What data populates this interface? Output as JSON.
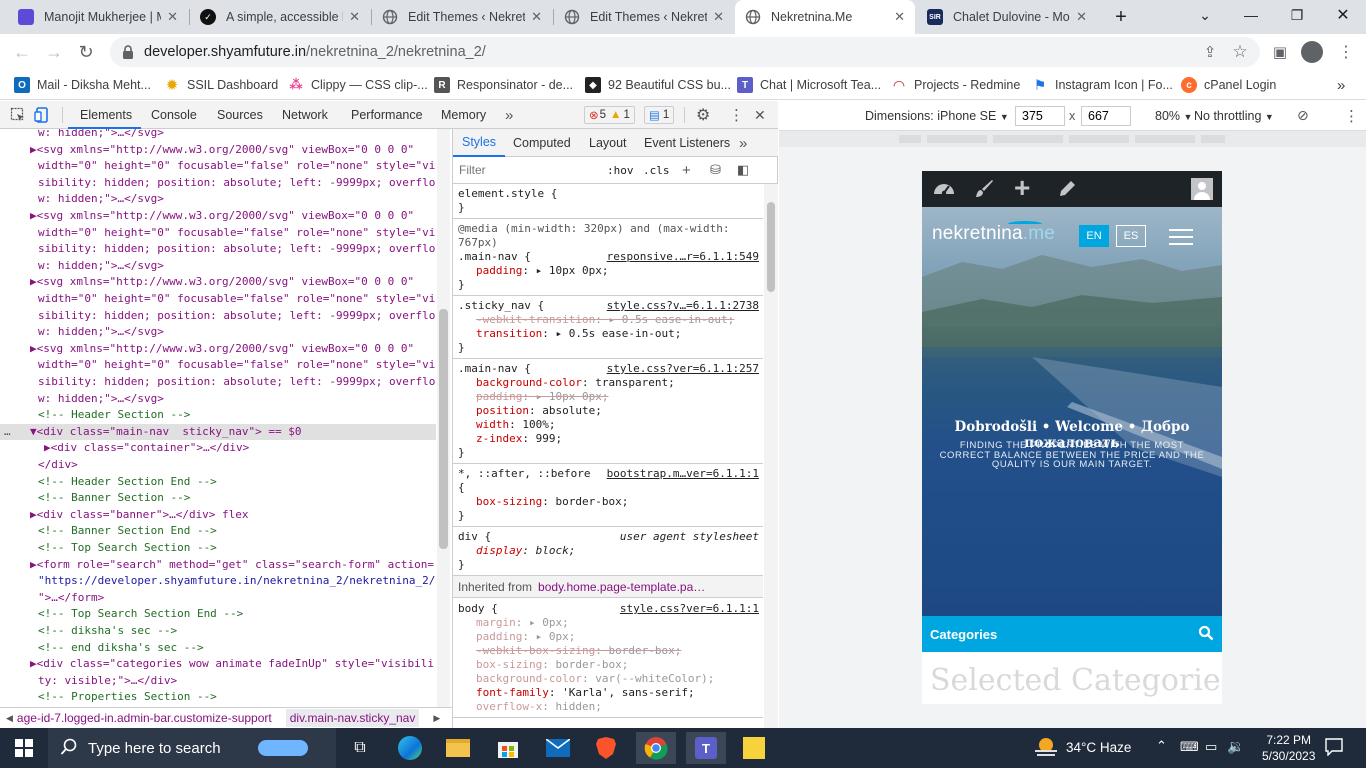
{
  "browser": {
    "tabs": [
      {
        "title": "Manojit Mukherjee | M",
        "favicon_color": "#5b4bd6",
        "favicon_text": "",
        "active": false
      },
      {
        "title": "A simple, accessible la",
        "favicon_color": "#111111",
        "favicon_text": "✓",
        "active": false
      },
      {
        "title": "Edit Themes ‹ Nekretn",
        "favicon_color": "#5f6368",
        "favicon_text": "",
        "active": false
      },
      {
        "title": "Edit Themes ‹ Nekretn",
        "favicon_color": "#5f6368",
        "favicon_text": "",
        "active": false
      },
      {
        "title": "Nekretnina.Me",
        "favicon_color": "#5f6368",
        "favicon_text": "",
        "active": true
      },
      {
        "title": "Chalet Dulovine - Mon",
        "favicon_color": "#1b2a5c",
        "favicon_text": "SIR",
        "active": false
      }
    ],
    "new_tab_label": "+",
    "url_domain": "developer.shyamfuture.in",
    "url_path": "/nekretnina_2/nekretnina_2/",
    "bookmarks": [
      {
        "label": "Mail - Diksha Meht...",
        "color": "#0f6cbd",
        "glyph": "O"
      },
      {
        "label": "SSIL Dashboard",
        "color": "#e8a800",
        "glyph": "✹"
      },
      {
        "label": "Clippy — CSS clip-...",
        "color": "#e84393",
        "glyph": "⁂"
      },
      {
        "label": "Responsinator - de...",
        "color": "#555555",
        "glyph": "R"
      },
      {
        "label": "92 Beautiful CSS bu...",
        "color": "#222222",
        "glyph": "◆"
      },
      {
        "label": "Chat | Microsoft Tea...",
        "color": "#5b5fc7",
        "glyph": "T"
      },
      {
        "label": "Projects - Redmine",
        "color": "#b32024",
        "glyph": "◠"
      },
      {
        "label": "Instagram Icon | Fo...",
        "color": "#1a73e8",
        "glyph": "⚑"
      },
      {
        "label": "cPanel Login",
        "color": "#ff6c2c",
        "glyph": "c"
      }
    ]
  },
  "devtools": {
    "tabs": [
      "Elements",
      "Console",
      "Sources",
      "Network",
      "Performance",
      "Memory"
    ],
    "more_tabs": "»",
    "errors": "5",
    "warnings": "1",
    "messages": "1",
    "elements_lines": [
      {
        "t": "w: hidden;\">…</svg>",
        "kind": "tagline",
        "indent": 38
      },
      {
        "t": "▶<svg xmlns=\"http://www.w3.org/2000/svg\" viewBox=\"0 0 0 0\"",
        "kind": "tag",
        "indent": 30
      },
      {
        "t": "width=\"0\" height=\"0\" focusable=\"false\" role=\"none\" style=\"vi",
        "kind": "tag",
        "indent": 38
      },
      {
        "t": "sibility: hidden; position: absolute; left: -9999px; overflo",
        "kind": "tag",
        "indent": 38
      },
      {
        "t": "w: hidden;\">…</svg>",
        "kind": "tag",
        "indent": 38
      },
      {
        "t": "▶<svg xmlns=\"http://www.w3.org/2000/svg\" viewBox=\"0 0 0 0\"",
        "kind": "tag",
        "indent": 30
      },
      {
        "t": "width=\"0\" height=\"0\" focusable=\"false\" role=\"none\" style=\"vi",
        "kind": "tag",
        "indent": 38
      },
      {
        "t": "sibility: hidden; position: absolute; left: -9999px; overflo",
        "kind": "tag",
        "indent": 38
      },
      {
        "t": "w: hidden;\">…</svg>",
        "kind": "tag",
        "indent": 38
      },
      {
        "t": "▶<svg xmlns=\"http://www.w3.org/2000/svg\" viewBox=\"0 0 0 0\"",
        "kind": "tag",
        "indent": 30
      },
      {
        "t": "width=\"0\" height=\"0\" focusable=\"false\" role=\"none\" style=\"vi",
        "kind": "tag",
        "indent": 38
      },
      {
        "t": "sibility: hidden; position: absolute; left: -9999px; overflo",
        "kind": "tag",
        "indent": 38
      },
      {
        "t": "w: hidden;\">…</svg>",
        "kind": "tag",
        "indent": 38
      },
      {
        "t": "▶<svg xmlns=\"http://www.w3.org/2000/svg\" viewBox=\"0 0 0 0\"",
        "kind": "tag",
        "indent": 30
      },
      {
        "t": "width=\"0\" height=\"0\" focusable=\"false\" role=\"none\" style=\"vi",
        "kind": "tag",
        "indent": 38
      },
      {
        "t": "sibility: hidden; position: absolute; left: -9999px; overflo",
        "kind": "tag",
        "indent": 38
      },
      {
        "t": "w: hidden;\">…</svg>",
        "kind": "tag",
        "indent": 38
      },
      {
        "t": "<!-- Header Section -->",
        "kind": "comment",
        "indent": 38
      },
      {
        "t": "▼<div class=\"main-nav  sticky_nav\"> == $0",
        "kind": "selected",
        "indent": 30
      },
      {
        "t": "▶<div class=\"container\">…</div>",
        "kind": "tag",
        "indent": 44
      },
      {
        "t": "</div>",
        "kind": "tag",
        "indent": 38
      },
      {
        "t": "<!-- Header Section End -->",
        "kind": "comment",
        "indent": 38
      },
      {
        "t": "<!-- Banner Section -->",
        "kind": "comment",
        "indent": 38
      },
      {
        "t": "▶<div class=\"banner\">…</div> flex",
        "kind": "tag",
        "indent": 30
      },
      {
        "t": "<!-- Banner Section End -->",
        "kind": "comment",
        "indent": 38
      },
      {
        "t": "<!-- Top Search Section -->",
        "kind": "comment",
        "indent": 38
      },
      {
        "t": "▶<form role=\"search\" method=\"get\" class=\"search-form\" action=",
        "kind": "tag",
        "indent": 30
      },
      {
        "t": "\"https://developer.shyamfuture.in/nekretnina_2/nekretnina_2/",
        "kind": "val",
        "indent": 38
      },
      {
        "t": "\">…</form>",
        "kind": "tag",
        "indent": 38
      },
      {
        "t": "<!-- Top Search Section End -->",
        "kind": "comment",
        "indent": 38
      },
      {
        "t": "<!-- diksha's sec -->",
        "kind": "comment",
        "indent": 38
      },
      {
        "t": "<!-- end diksha's sec -->",
        "kind": "comment",
        "indent": 38
      },
      {
        "t": "▶<div class=\"categories wow animate fadeInUp\" style=\"visibili",
        "kind": "tag",
        "indent": 30
      },
      {
        "t": "ty: visible;\">…</div>",
        "kind": "tag",
        "indent": 38
      },
      {
        "t": "<!-- Properties Section -->",
        "kind": "comment",
        "indent": 38
      }
    ],
    "breadcrumbs": [
      "age-id-7.logged-in.admin-bar.customize-support",
      "div.main-nav.sticky_nav"
    ],
    "styles_tabs": [
      "Styles",
      "Computed",
      "Layout",
      "Event Listeners"
    ],
    "filter_placeholder": "Filter",
    "hov": ":hov",
    "cls": ".cls",
    "rules": [
      {
        "selector": "element.style {",
        "source": "",
        "props": [],
        "close": "}"
      },
      {
        "selector": "@media (min-width: 320px) and (max-width: 767px)",
        "selector2": ".main-nav {",
        "source": "responsive.…r=6.1.1:549",
        "props": [
          {
            "n": "padding",
            "v": "▸ 10px 0px;",
            "s": "normal"
          }
        ],
        "close": "}"
      },
      {
        "selector": ".sticky_nav {",
        "source": "style.css?v…=6.1.1:2738",
        "props": [
          {
            "n": "-webkit-transition",
            "v": "▸ 0.5s ease-in-out;",
            "s": "strike"
          },
          {
            "n": "transition",
            "v": "▸ 0.5s ease-in-out;",
            "s": "normal"
          }
        ],
        "close": "}"
      },
      {
        "selector": ".main-nav {",
        "source": "style.css?ver=6.1.1:257",
        "props": [
          {
            "n": "background-color",
            "v": "transparent;",
            "s": "normal"
          },
          {
            "n": "padding",
            "v": "▸ 10px 0px;",
            "s": "strike"
          },
          {
            "n": "position",
            "v": "absolute;",
            "s": "normal"
          },
          {
            "n": "width",
            "v": "100%;",
            "s": "normal"
          },
          {
            "n": "z-index",
            "v": "999;",
            "s": "normal"
          }
        ],
        "close": "}"
      },
      {
        "selector": "*, ::after, ::before",
        "selector2": "{",
        "source": "bootstrap.m…ver=6.1.1:1",
        "props": [
          {
            "n": "box-sizing",
            "v": "border-box;",
            "s": "normal"
          }
        ],
        "close": "}"
      },
      {
        "selector": "div {",
        "source": "user agent stylesheet",
        "props": [
          {
            "n": "display",
            "v": "block;",
            "s": "italic"
          }
        ],
        "close": "}"
      }
    ],
    "inherited_label": "Inherited from",
    "inherited_from": "body.home.page-template.pa…",
    "body_rule": {
      "selector": "body {",
      "source": "style.css?ver=6.1.1:1",
      "props": [
        {
          "n": "margin",
          "v": "▸ 0px;",
          "s": "inherit"
        },
        {
          "n": "padding",
          "v": "▸ 0px;",
          "s": "inherit"
        },
        {
          "n": "-webkit-box-sizing",
          "v": "border-box;",
          "s": "strike"
        },
        {
          "n": "box-sizing",
          "v": "border-box;",
          "s": "inherit"
        },
        {
          "n": "background-color",
          "v": "var(--whiteColor);",
          "s": "inherit"
        },
        {
          "n": "font-family",
          "v": "'Karla', sans-serif;",
          "s": "normal"
        },
        {
          "n": "overflow-x",
          "v": "hidden;",
          "s": "inherit"
        }
      ]
    }
  },
  "device_toolbar": {
    "dimensions_label": "Dimensions: iPhone SE",
    "width": "375",
    "height": "667",
    "times": "x",
    "zoom": "80%",
    "throttle": "No throttling"
  },
  "site": {
    "logo_main": "nekretnina",
    "logo_suffix": ".me",
    "lang_en": "EN",
    "lang_es": "ES",
    "welcome": "Dobrodošli • Welcome • Добро пожаловать",
    "tagline": "FINDING THE PROPERTIES WITH THE MOST CORRECT BALANCE BETWEEN THE PRICE AND THE QUALITY IS OUR MAIN TARGET.",
    "categories_label": "Categories",
    "selected_categories": "Selected Categories"
  },
  "taskbar": {
    "search_placeholder": "Type here to search",
    "weather": "34°C  Haze",
    "time": "7:22 PM",
    "date": "5/30/2023"
  }
}
